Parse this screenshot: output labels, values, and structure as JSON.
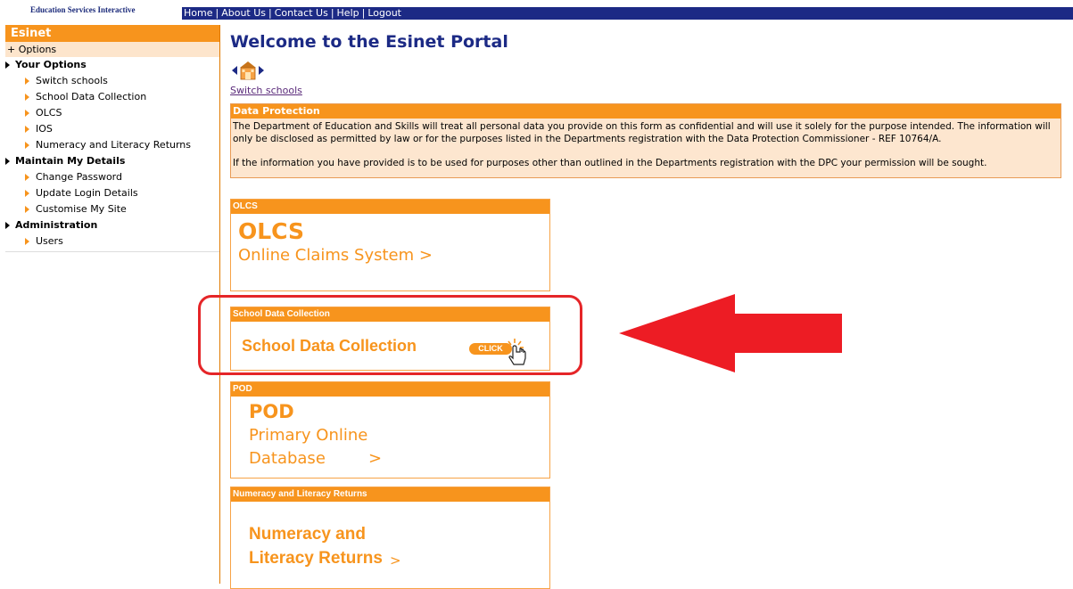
{
  "brand": "Education Services Interactive",
  "topnav": [
    "Home",
    "About Us",
    "Contact Us",
    "Help",
    "Logout"
  ],
  "sidebar": {
    "title": "Esinet",
    "options": "+ Options",
    "sections": [
      {
        "label": "Your Options",
        "items": [
          "Switch schools",
          "School Data Collection",
          "OLCS",
          "IOS",
          "Numeracy and Literacy Returns"
        ]
      },
      {
        "label": "Maintain My Details",
        "items": [
          "Change Password",
          "Update Login Details",
          "Customise My Site"
        ]
      },
      {
        "label": "Administration",
        "items": [
          "Users"
        ]
      }
    ]
  },
  "main": {
    "title": "Welcome to the Esinet Portal",
    "switch_link": "Switch schools",
    "data_protection": {
      "heading": "Data Protection",
      "para1": "The Department of Education and Skills will treat all personal data you provide on this form as confidential and will use it solely for the purpose intended. The information will only be disclosed as permitted by law or for the purposes listed in the Departments registration with the Data Protection Commissioner - REF 10764/A.",
      "para2": "If the information you have provided is to be used for purposes other than outlined in the Departments registration with the DPC your permission will be sought."
    },
    "panels": {
      "olcs": {
        "head": "OLCS",
        "big": "OLCS",
        "sub": "Online Claims System >"
      },
      "sdc": {
        "head": "School Data Collection",
        "big": "School Data Collection",
        "badge": "CLICK"
      },
      "pod": {
        "head": "POD",
        "big": "POD",
        "sub1": "Primary Online",
        "sub2": "Database",
        "chev": ">"
      },
      "nlr": {
        "head": "Numeracy and Literacy Returns",
        "big1": "Numeracy and",
        "big2": "Literacy Returns",
        "chev": ">"
      }
    }
  },
  "colors": {
    "nav": "#1c2a85",
    "orange": "#f7941d",
    "highlight": "#e52528"
  },
  "icons": [
    "switch-schools-icon",
    "hand-pointer-icon",
    "red-arrow-icon"
  ]
}
